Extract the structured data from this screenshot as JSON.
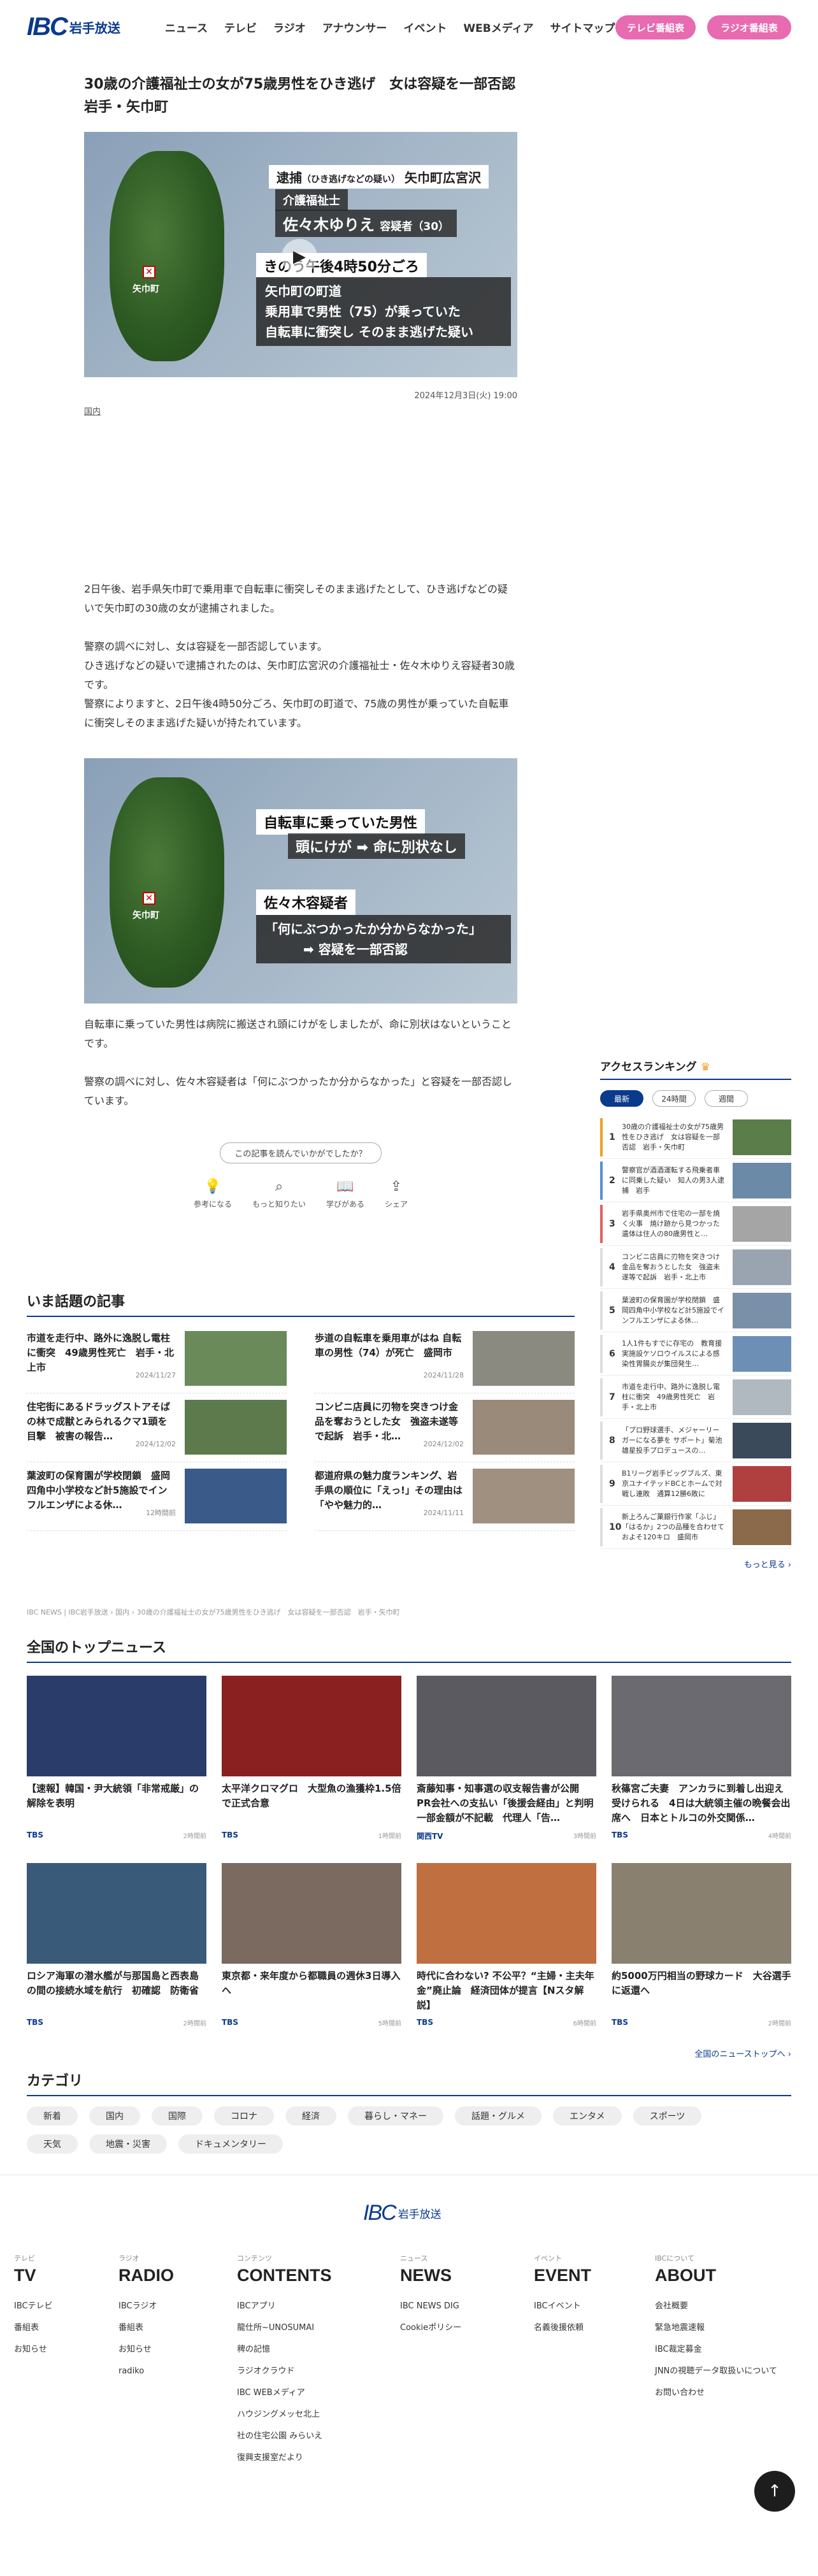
{
  "header": {
    "logo_mark": "IBC",
    "logo_text": "岩手放送",
    "nav": [
      "ニュース",
      "テレビ",
      "ラジオ",
      "アナウンサー",
      "イベント",
      "WEBメディア",
      "サイトマップ"
    ],
    "tv_button": "テレビ番組表",
    "radio_button": "ラジオ番組表"
  },
  "article": {
    "title": "30歳の介護福祉士の女が75歳男性をひき逃げ　女は容疑を一部否認　岩手・矢巾町",
    "hero": {
      "town": "矢巾町",
      "l1a": "逮捕",
      "l1b": "（ひき逃げなどの疑い）",
      "l1c": "矢巾町広宮沢",
      "l2": "介護福祉士",
      "l3a": "佐々木ゆりえ",
      "l3b": "容疑者（30）",
      "l4": "きのう午後4時50分ごろ",
      "l5": "矢巾町の町道",
      "l6": "乗用車で男性（75）が乗っていた",
      "l7": "自転車に衝突し そのまま逃げた疑い"
    },
    "date": "2024年12月3日(火) 19:00",
    "category": "国内",
    "paragraphs": [
      "2日午後、岩手県矢巾町で乗用車で自転車に衝突しそのまま逃げたとして、ひき逃げなどの疑いで矢巾町の30歳の女が逮捕されました。",
      "警察の調べに対し、女は容疑を一部否認しています。",
      "ひき逃げなどの疑いで逮捕されたのは、矢巾町広宮沢の介護福祉士・佐々木ゆりえ容疑者30歳です。",
      "警察によりますと、2日午後4時50分ごろ、矢巾町の町道で、75歳の男性が乗っていた自転車に衝突しそのまま逃げた疑いが持たれています。"
    ],
    "hero2": {
      "town": "矢巾町",
      "a": "自転車に乗っていた男性",
      "b": "頭にけが ➡ 命に別状なし",
      "c": "佐々木容疑者",
      "d": "「何にぶつかったか分からなかった」",
      "e": "➡ 容疑を一部否認"
    },
    "paragraphs2": [
      "自転車に乗っていた男性は病院に搬送され頭にけがをしましたが、命に別状はないということです。",
      "警察の調べに対し、佐々木容疑者は「何にぶつかったか分からなかった」と容疑を一部否認しています。"
    ],
    "feedback_question": "この記事を読んでいかがでしたか？",
    "feedback": [
      "参考になる",
      "もっと知りたい",
      "学びがある",
      "シェア"
    ]
  },
  "ranking": {
    "title": "アクセスランキング",
    "tabs": [
      "最新",
      "24時間",
      "週間"
    ],
    "items": [
      {
        "n": "1",
        "t": "30歳の介護福祉士の女が75歳男性をひき逃げ　女は容疑を一部否認　岩手・矢巾町"
      },
      {
        "n": "2",
        "t": "警察官が酒酒運転する飛乗者車に同乗した疑い　知人の男3人逮捕　岩手"
      },
      {
        "n": "3",
        "t": "岩手県奥州市で住宅の一部を焼く火事　焼け跡から見つかった遺体は住人の80歳男性と…"
      },
      {
        "n": "4",
        "t": "コンビニ店員に刃物を突きつけ金品を奪おうとした女　強盗未遂等で起訴　岩手・北上市"
      },
      {
        "n": "5",
        "t": "葉波町の保育園が学校閉鎖　盛岡四角中小学校など計5施設でインフルエンザによる休…"
      },
      {
        "n": "6",
        "t": "1人1件もすでに存宅の　教育援実施設ケソロウイルスによる感染性胃腸炎が集団発生…"
      },
      {
        "n": "7",
        "t": "市道を走行中、路外に逸脱し電柱に衝突　49歳男性死亡　岩手・北上市"
      },
      {
        "n": "8",
        "t": "「プロ野球選手、メジャーリーガーになる夢を サポート」菊池雄星投手プロデュースの…"
      },
      {
        "n": "9",
        "t": "B1リーグ岩手ビッグブルズ、東京ユナイテッドBCとホームで対戦し連敗　通算12勝6敗に"
      },
      {
        "n": "10",
        "t": "新上ろんご菓銀行作家「ふじ」「はるか」2つの品種を合わせておよそ120キロ　盛岡市"
      }
    ],
    "more": "もっと見る ›"
  },
  "trending": {
    "title": "いま話題の記事",
    "items": [
      {
        "t": "市道を走行中、路外に逸脱し電柱に衝突　49歳男性死亡　岩手・北上市",
        "d": "2024/11/27"
      },
      {
        "t": "歩道の自転車を乗用車がはね 自転車の男性（74）が死亡　盛岡市",
        "d": "2024/11/28"
      },
      {
        "t": "住宅街にあるドラッグストアそばの林で成獣とみられるクマ1頭を目撃　被害の報告…",
        "d": "2024/12/02"
      },
      {
        "t": "コンビニ店員に刃物を突きつけ金品を奪おうとした女　強盗未遂等で起訴　岩手・北…",
        "d": "2024/12/02"
      },
      {
        "t": "葉波町の保育園が学校閉鎖　盛岡四角中小学校など計5施設でインフルエンザによる休…",
        "d": "12時間前"
      },
      {
        "t": "都道府県の魅力度ランキング、岩手県の順位に「えっ!」その理由は「やや魅力的…",
        "d": "2024/11/11"
      }
    ]
  },
  "breadcrumb": "IBC NEWS | IBC岩手放送 › 国内 › 30歳の介護福祉士の女が75歳男性をひき逃げ　女は容疑を一部否認　岩手・矢巾町",
  "national": {
    "title": "全国のトップニュース",
    "items": [
      {
        "t": "【速報】韓国・尹大統領「非常戒厳」の解除を表明",
        "s": "TBS",
        "time": "2時間前"
      },
      {
        "t": "太平洋クロマグロ　大型魚の漁獲枠1.5倍で正式合意",
        "s": "TBS",
        "time": "1時間前"
      },
      {
        "t": "斎藤知事・知事選の収支報告書が公開　PR会社への支払い「後援会経由」と判明　一部金額が不記載　代理人「告…",
        "s": "関西TV",
        "time": "3時間前"
      },
      {
        "t": "秋篠宮ご夫妻　アンカラに到着し出迎え受けられる　4日は大統領主催の晩餐会出席へ　日本とトルコの外交関係…",
        "s": "TBS",
        "time": "4時間前"
      },
      {
        "t": "ロシア海軍の潜水艦が与那国島と西表島の間の接続水域を航行　初確認　防衛省",
        "s": "TBS",
        "time": "2時間前"
      },
      {
        "t": "東京都・来年度から都職員の週休3日導入へ",
        "s": "TBS",
        "time": "5時間前"
      },
      {
        "t": "時代に合わない? 不公平？“主婦・主夫年金”廃止論　経済団体が提言【Nスタ解説】",
        "s": "TBS",
        "time": "6時間前"
      },
      {
        "t": "約5000万円相当の野球カード　大谷選手に返還へ",
        "s": "TBS",
        "time": "2時間前"
      }
    ],
    "more": "全国のニューストップへ ›"
  },
  "categories": {
    "title": "カテゴリ",
    "items": [
      "新着",
      "国内",
      "国際",
      "コロナ",
      "経済",
      "暮らし・マネー",
      "話題・グルメ",
      "エンタメ",
      "スポーツ",
      "天気",
      "地震・災害",
      "ドキュメンタリー"
    ]
  },
  "footer": {
    "cols": [
      {
        "sm": "テレビ",
        "big": "TV",
        "links": [
          "IBCテレビ",
          "番組表",
          "お知らせ"
        ]
      },
      {
        "sm": "ラジオ",
        "big": "RADIO",
        "links": [
          "IBCラジオ",
          "番組表",
          "お知らせ",
          "radiko"
        ]
      },
      {
        "sm": "コンテンツ",
        "big": "CONTENTS",
        "links": [
          "IBCアプリ",
          "龍仕所~UNOSUMAI",
          "稗の記憶",
          "ラジオクラウド",
          "IBC WEBメディア",
          "ハウジングメッセ北上",
          "社の住宅公園 みらいえ",
          "復興支援室だより"
        ]
      },
      {
        "sm": "ニュース",
        "big": "NEWS",
        "links": [
          "IBC NEWS DIG",
          "Cookieポリシー"
        ]
      },
      {
        "sm": "イベント",
        "big": "EVENT",
        "links": [
          "IBCイベント",
          "名義後援依頼"
        ]
      },
      {
        "sm": "IBCについて",
        "big": "ABOUT",
        "links": [
          "会社概要",
          "緊急地震速報",
          "IBC裁定募金",
          "JNNの視聴データ取扱いについて",
          "お問い合わせ"
        ]
      }
    ]
  }
}
